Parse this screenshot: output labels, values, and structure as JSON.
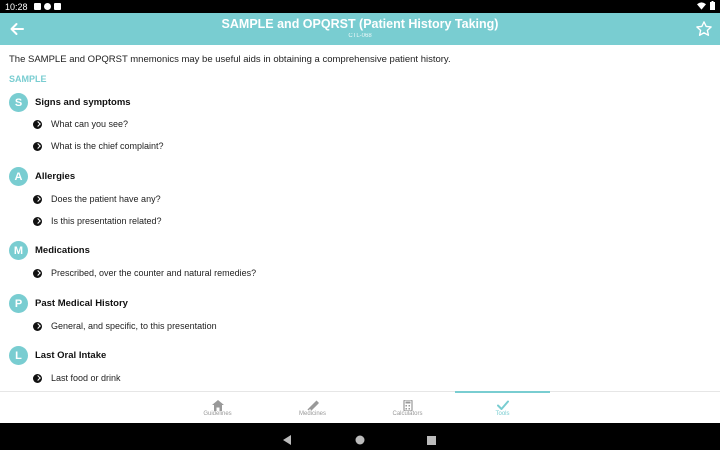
{
  "status_bar": {
    "time": "10:28"
  },
  "app_bar": {
    "title": "SAMPLE and OPQRST (Patient History Taking)",
    "code": "CTL-068",
    "accent": "#79cdd1"
  },
  "intro": "The SAMPLE and OPQRST mnemonics may be useful aids in obtaining a comprehensive patient history.",
  "section": "SAMPLE",
  "groups": [
    {
      "letter": "S",
      "title": "Signs and symptoms",
      "items": [
        "What can you see?",
        "What is the chief complaint?"
      ]
    },
    {
      "letter": "A",
      "title": "Allergies",
      "items": [
        "Does the patient have any?",
        "Is this presentation related?"
      ]
    },
    {
      "letter": "M",
      "title": "Medications",
      "items": [
        "Prescribed, over the counter and natural remedies?"
      ]
    },
    {
      "letter": "P",
      "title": "Past Medical History",
      "items": [
        "General, and specific, to this presentation"
      ]
    },
    {
      "letter": "L",
      "title": "Last Oral Intake",
      "items": [
        "Last food or drink"
      ]
    }
  ],
  "bottom_nav": [
    {
      "label": "Guidelines",
      "icon": "home-icon",
      "active": false
    },
    {
      "label": "Medicines",
      "icon": "syringe-icon",
      "active": false
    },
    {
      "label": "Calculators",
      "icon": "calculator-icon",
      "active": false
    },
    {
      "label": "Tools",
      "icon": "check-icon",
      "active": true
    }
  ]
}
